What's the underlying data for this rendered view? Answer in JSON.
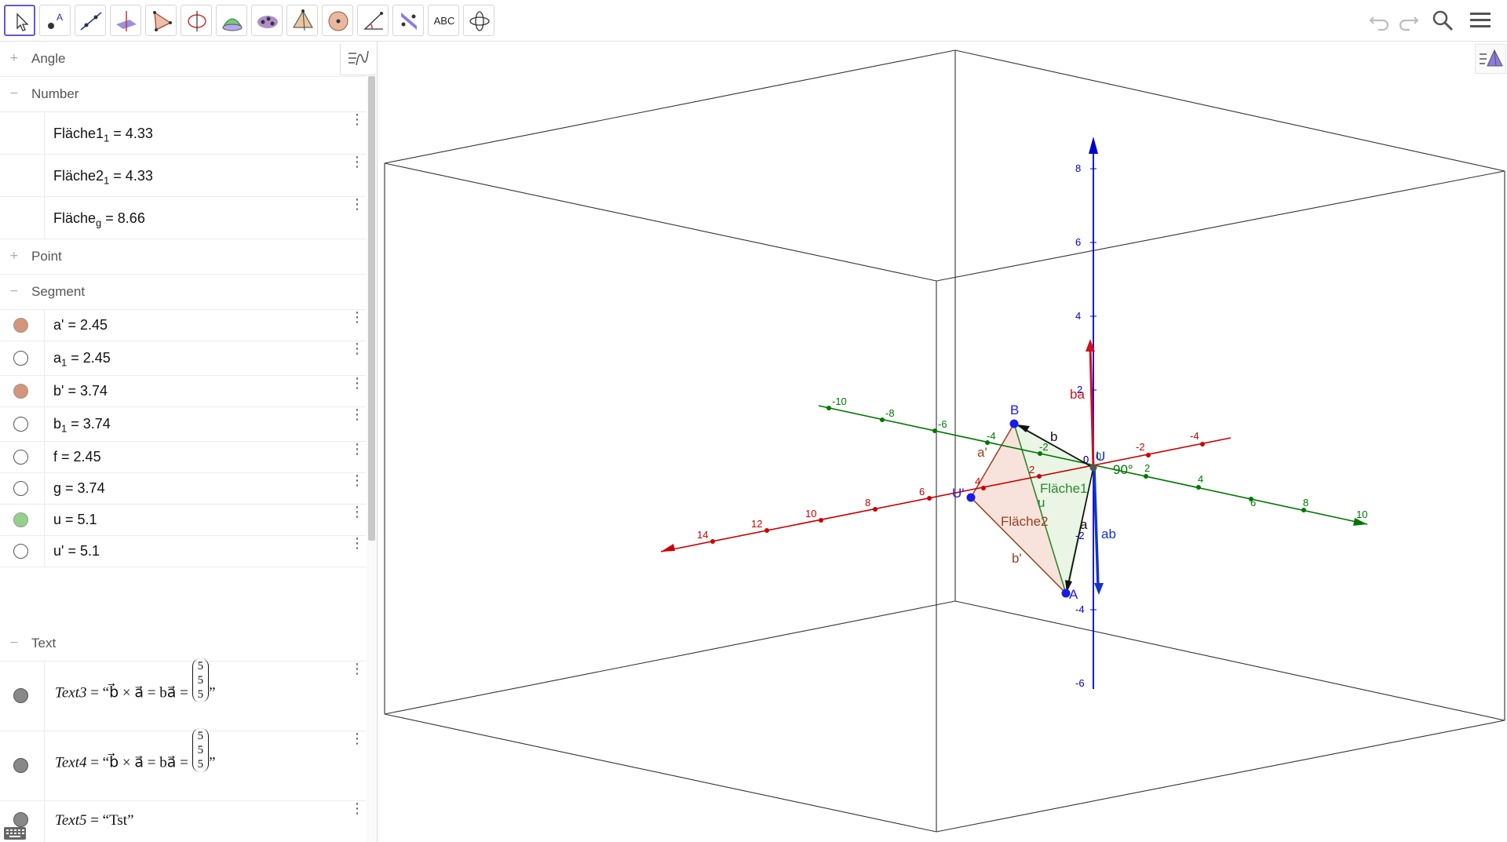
{
  "toolbar": {
    "tools": [
      {
        "icon": "move-arrow-icon",
        "selected": true
      },
      {
        "icon": "point-icon",
        "selected": false
      },
      {
        "icon": "line-icon",
        "selected": false
      },
      {
        "icon": "perpendicular-line-icon",
        "selected": false
      },
      {
        "icon": "polygon-icon",
        "selected": false
      },
      {
        "icon": "circle-axis-icon",
        "selected": false
      },
      {
        "icon": "intersect-surfaces-icon",
        "selected": false
      },
      {
        "icon": "plane-three-points-icon",
        "selected": false
      },
      {
        "icon": "pyramid-icon",
        "selected": false
      },
      {
        "icon": "sphere-icon",
        "selected": false
      },
      {
        "icon": "angle-icon",
        "selected": false
      },
      {
        "icon": "reflect-plane-icon",
        "selected": false
      },
      {
        "icon": "text-icon",
        "label": "ABC",
        "selected": false
      },
      {
        "icon": "rotate-view-icon",
        "selected": false
      }
    ],
    "right": [
      "undo-icon",
      "redo-icon",
      "search-icon",
      "menu-icon"
    ]
  },
  "algebra": {
    "groups": {
      "angle": "Angle",
      "number": "Number",
      "point": "Point",
      "segment": "Segment",
      "text": "Text"
    },
    "numbers": [
      {
        "name": "Fläche1",
        "sub": "1",
        "value": "= 4.33"
      },
      {
        "name": "Fläche2",
        "sub": "1",
        "value": "= 4.33"
      },
      {
        "name": "Fläche",
        "sub": "g",
        "value": "= 8.66"
      }
    ],
    "segments": [
      {
        "name": "a'",
        "sub": "",
        "value": "= 2.45",
        "marble": "#d4957a",
        "filled": true
      },
      {
        "name": "a",
        "sub": "1",
        "value": "= 2.45",
        "marble": "#ffffff",
        "filled": false
      },
      {
        "name": "b'",
        "sub": "",
        "value": "= 3.74",
        "marble": "#d4957a",
        "filled": true
      },
      {
        "name": "b",
        "sub": "1",
        "value": "= 3.74",
        "marble": "#ffffff",
        "filled": false
      },
      {
        "name": "f",
        "sub": "",
        "value": "= 2.45",
        "marble": "#ffffff",
        "filled": false
      },
      {
        "name": "g",
        "sub": "",
        "value": "= 3.74",
        "marble": "#ffffff",
        "filled": false
      },
      {
        "name": "u",
        "sub": "",
        "value": "= 5.1",
        "marble": "#93d08a",
        "filled": true
      },
      {
        "name": "u'",
        "sub": "",
        "value": "= 5.1",
        "marble": "#ffffff",
        "filled": false
      }
    ],
    "texts": [
      {
        "name": "Text3",
        "formula": "= “b⃗ × a⃗ = ba⃗ = ",
        "vector": [
          "5",
          "5",
          "5"
        ],
        "close": "”"
      },
      {
        "name": "Text4",
        "formula": "= “b⃗ × a⃗ = ba⃗ = ",
        "vector": [
          "5",
          "5",
          "5"
        ],
        "close": "”"
      },
      {
        "name": "Text5",
        "formula": "= “Tst”",
        "vector": [],
        "close": ""
      }
    ]
  },
  "view3d": {
    "x_ticks": [
      "14",
      "12",
      "10",
      "8",
      "6",
      "4",
      "2",
      "0",
      "-2",
      "-4"
    ],
    "y_ticks": [
      "-10",
      "-8",
      "-6",
      "-4",
      "-2",
      "0",
      "2",
      "4",
      "6",
      "8",
      "10"
    ],
    "z_ticks": [
      "8",
      "6",
      "4",
      "2",
      "0",
      "-2",
      "-4",
      "-6"
    ],
    "labels": {
      "B": "B",
      "A": "A",
      "U": "U",
      "U_prime": "U'",
      "b": "b",
      "a": "a",
      "a_prime": "a'",
      "b_prime": "b'",
      "u": "u",
      "ba": "ba",
      "ab": "ab",
      "flache1": "Fläche1",
      "flache2": "Fläche2",
      "angle": "90°"
    },
    "colors": {
      "x_axis": "#cc0000",
      "y_axis": "#007700",
      "z_axis": "#0000cc",
      "points": "#1a1ae6"
    }
  }
}
